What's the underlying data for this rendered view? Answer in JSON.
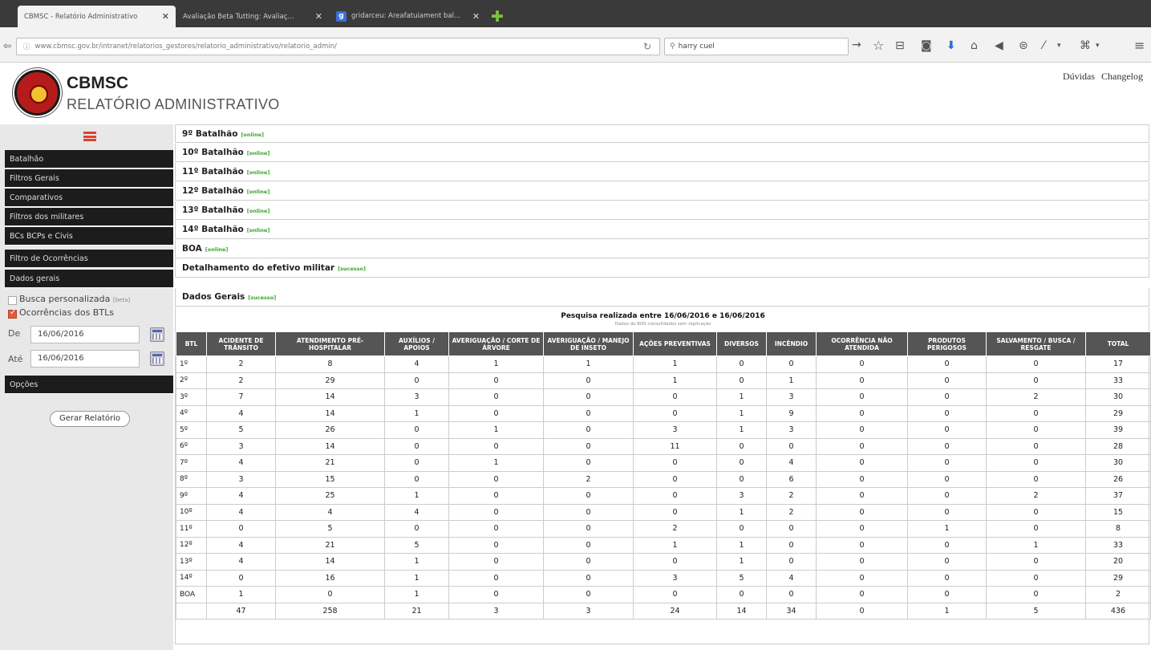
{
  "tabs": [
    {
      "title": "CBMSC - Relatório Administrativo"
    },
    {
      "title": "Avaliação Beta Tutting: Avaliaç..."
    },
    {
      "title": "gridarceu: Areafatuiament bal..."
    }
  ],
  "browser": {
    "url": "www.cbmsc.gov.br/intranet/relatorios_gestores/relatorio_administrativo/relatorio_admin/",
    "search_value": "harry cuel"
  },
  "header": {
    "brand": "CBMSC",
    "subtitle": "RELATÓRIO ADMINISTRATIVO",
    "links": [
      "Dúvidas",
      "Changelog"
    ]
  },
  "sidebar": {
    "nav": [
      "Batalhão",
      "Filtros Gerais",
      "Comparativos",
      "Filtros dos militares",
      "BCs BCPs e Civis",
      "Filtro de Ocorrências",
      "Dados gerais"
    ],
    "custom_search_label": "Busca personalizada",
    "custom_search_tag": "[beta]",
    "btl_occurrences_label": "Ocorrências dos BTLs",
    "from_label": "De",
    "from_value": "16/06/2016",
    "to_label": "Até",
    "to_value": "16/06/2016",
    "options_label": "Opções",
    "generate_button": "Gerar Relatório"
  },
  "sections": [
    {
      "title": "9º Batalhão",
      "status": "[online]"
    },
    {
      "title": "10º Batalhão",
      "status": "[online]"
    },
    {
      "title": "11º Batalhão",
      "status": "[online]"
    },
    {
      "title": "12º Batalhão",
      "status": "[online]"
    },
    {
      "title": "13º Batalhão",
      "status": "[online]"
    },
    {
      "title": "14º Batalhão",
      "status": "[online]"
    },
    {
      "title": "BOA",
      "status": "[online]"
    },
    {
      "title": "Detalhamento do efetivo militar",
      "status": "[sucesso]"
    },
    {
      "title": "Dados Gerais",
      "status": "[sucesso]"
    }
  ],
  "report": {
    "title": "Pesquisa realizada entre 16/06/2016 e 16/06/2016",
    "subtitle": "Dados do BOS consolidados sem replicação",
    "columns": [
      "BTL",
      "ACIDENTE DE TRÂNSITO",
      "ATENDIMENTO PRÉ-HOSPITALAR",
      "AUXÍLIOS / APOIOS",
      "AVERIGUAÇÃO / CORTE DE ÁRVORE",
      "AVERIGUAÇÃO / MANEJO DE INSETO",
      "AÇÕES PREVENTIVAS",
      "DIVERSOS",
      "INCÊNDIO",
      "OCORRÊNCIA NÃO ATENDIDA",
      "PRODUTOS PERIGOSOS",
      "SALVAMENTO / BUSCA / RESGATE",
      "TOTAL"
    ],
    "rows": [
      [
        "1º",
        "2",
        "8",
        "4",
        "1",
        "1",
        "1",
        "0",
        "0",
        "0",
        "0",
        "0",
        "17"
      ],
      [
        "2º",
        "2",
        "29",
        "0",
        "0",
        "0",
        "1",
        "0",
        "1",
        "0",
        "0",
        "0",
        "33"
      ],
      [
        "3º",
        "7",
        "14",
        "3",
        "0",
        "0",
        "0",
        "1",
        "3",
        "0",
        "0",
        "2",
        "30"
      ],
      [
        "4º",
        "4",
        "14",
        "1",
        "0",
        "0",
        "0",
        "1",
        "9",
        "0",
        "0",
        "0",
        "29"
      ],
      [
        "5º",
        "5",
        "26",
        "0",
        "1",
        "0",
        "3",
        "1",
        "3",
        "0",
        "0",
        "0",
        "39"
      ],
      [
        "6º",
        "3",
        "14",
        "0",
        "0",
        "0",
        "11",
        "0",
        "0",
        "0",
        "0",
        "0",
        "28"
      ],
      [
        "7º",
        "4",
        "21",
        "0",
        "1",
        "0",
        "0",
        "0",
        "4",
        "0",
        "0",
        "0",
        "30"
      ],
      [
        "8º",
        "3",
        "15",
        "0",
        "0",
        "2",
        "0",
        "0",
        "6",
        "0",
        "0",
        "0",
        "26"
      ],
      [
        "9º",
        "4",
        "25",
        "1",
        "0",
        "0",
        "0",
        "3",
        "2",
        "0",
        "0",
        "2",
        "37"
      ],
      [
        "10º",
        "4",
        "4",
        "4",
        "0",
        "0",
        "0",
        "1",
        "2",
        "0",
        "0",
        "0",
        "15"
      ],
      [
        "11º",
        "0",
        "5",
        "0",
        "0",
        "0",
        "2",
        "0",
        "0",
        "0",
        "1",
        "0",
        "8"
      ],
      [
        "12º",
        "4",
        "21",
        "5",
        "0",
        "0",
        "1",
        "1",
        "0",
        "0",
        "0",
        "1",
        "33"
      ],
      [
        "13º",
        "4",
        "14",
        "1",
        "0",
        "0",
        "0",
        "1",
        "0",
        "0",
        "0",
        "0",
        "20"
      ],
      [
        "14º",
        "0",
        "16",
        "1",
        "0",
        "0",
        "3",
        "5",
        "4",
        "0",
        "0",
        "0",
        "29"
      ],
      [
        "BOA",
        "1",
        "0",
        "1",
        "0",
        "0",
        "0",
        "0",
        "0",
        "0",
        "0",
        "0",
        "2"
      ],
      [
        "",
        "47",
        "258",
        "21",
        "3",
        "3",
        "24",
        "14",
        "34",
        "0",
        "1",
        "5",
        "436"
      ]
    ]
  }
}
